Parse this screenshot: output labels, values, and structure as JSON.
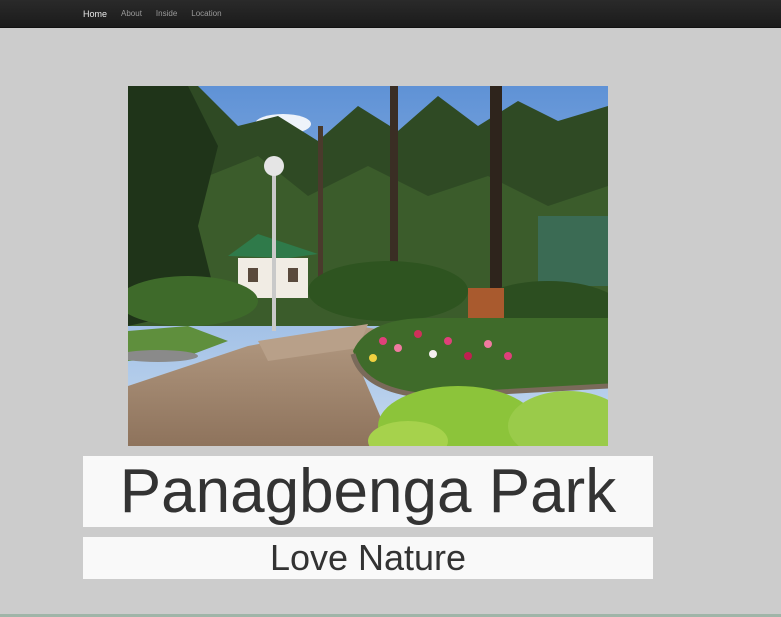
{
  "nav": {
    "items": [
      {
        "label": "Home",
        "active": true
      },
      {
        "label": "About",
        "active": false
      },
      {
        "label": "Inside",
        "active": false
      },
      {
        "label": "Location",
        "active": false
      }
    ]
  },
  "hero": {
    "title": "Panagbenga Park",
    "subtitle": "Love Nature"
  },
  "colors": {
    "navbar": "#1f1f1f",
    "page_background": "#cccccc",
    "text_box_background": "#f9f9f9",
    "heading_text": "#333333"
  }
}
